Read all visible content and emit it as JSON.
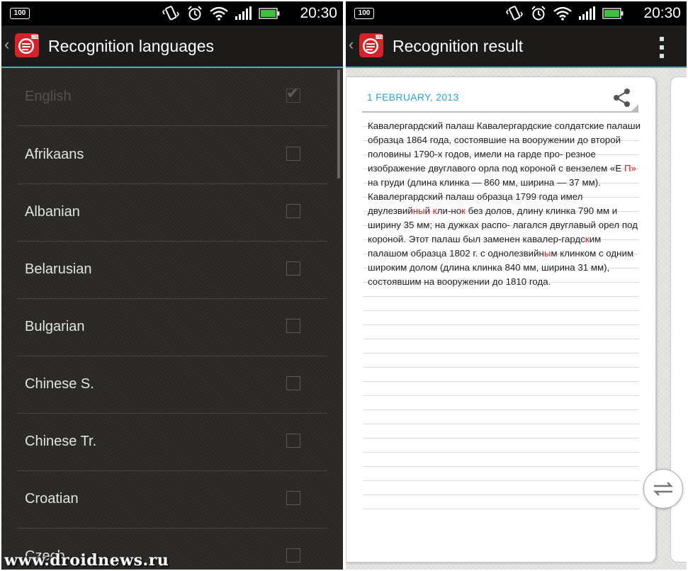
{
  "status_bar": {
    "battery_percent": "100",
    "time": "20:30",
    "icons": [
      "vibrate-icon",
      "alarm-icon",
      "wifi-icon",
      "signal-icon",
      "battery-icon"
    ]
  },
  "left_screen": {
    "title": "Recognition languages",
    "languages": [
      {
        "label": "English",
        "checked": true,
        "disabled": true
      },
      {
        "label": "Afrikaans",
        "checked": false
      },
      {
        "label": "Albanian",
        "checked": false
      },
      {
        "label": "Belarusian",
        "checked": false
      },
      {
        "label": "Bulgarian",
        "checked": false
      },
      {
        "label": "Chinese S.",
        "checked": false
      },
      {
        "label": "Chinese Tr.",
        "checked": false
      },
      {
        "label": "Croatian",
        "checked": false
      },
      {
        "label": "Czech",
        "checked": false
      }
    ],
    "watermark": "www.droidnews.ru"
  },
  "right_screen": {
    "title": "Recognition result",
    "note_date": "1 FEBRUARY, 2013",
    "note_paragraph": [
      {
        "t": "Кавалергардский палаш Кавалергардские солдатские палаши образца 1864 года, состоявшие на вооружении до второй половины 1790-х годов, имели на гарде про- резное изображение двуглавого орла под короной с вензелем «Е "
      },
      {
        "t": "П»",
        "err": true
      },
      {
        "t": " на груди (длина клинка — 860 мм, ширина — 37 мм). Кавалергардский палаш образца 1799 года имел двулезвий"
      },
      {
        "t": "ны",
        "err": true
      },
      {
        "t": "й "
      },
      {
        "t": "к",
        "err": true
      },
      {
        "t": "ли-но"
      },
      {
        "t": "к",
        "err": true
      },
      {
        "t": " без долов, длину клинка 790 мм и ширину 35 мм; на дужках распо- лагался двуглавый орел под короной. Этот палаш был заменен кавалер-гардс"
      },
      {
        "t": "к",
        "err": true
      },
      {
        "t": "им палашом образца 1802 г. с однолезвийн"
      },
      {
        "t": "ы",
        "err": true
      },
      {
        "t": "м клинком с одним широким долом (длина клинка 840 мм, ширина 31 мм), состоявшим на вооружении до 1810 года."
      }
    ]
  },
  "colors": {
    "accent": "#3fb4d8",
    "error_text": "#e01b1b",
    "logo_red": "#d8222a"
  }
}
